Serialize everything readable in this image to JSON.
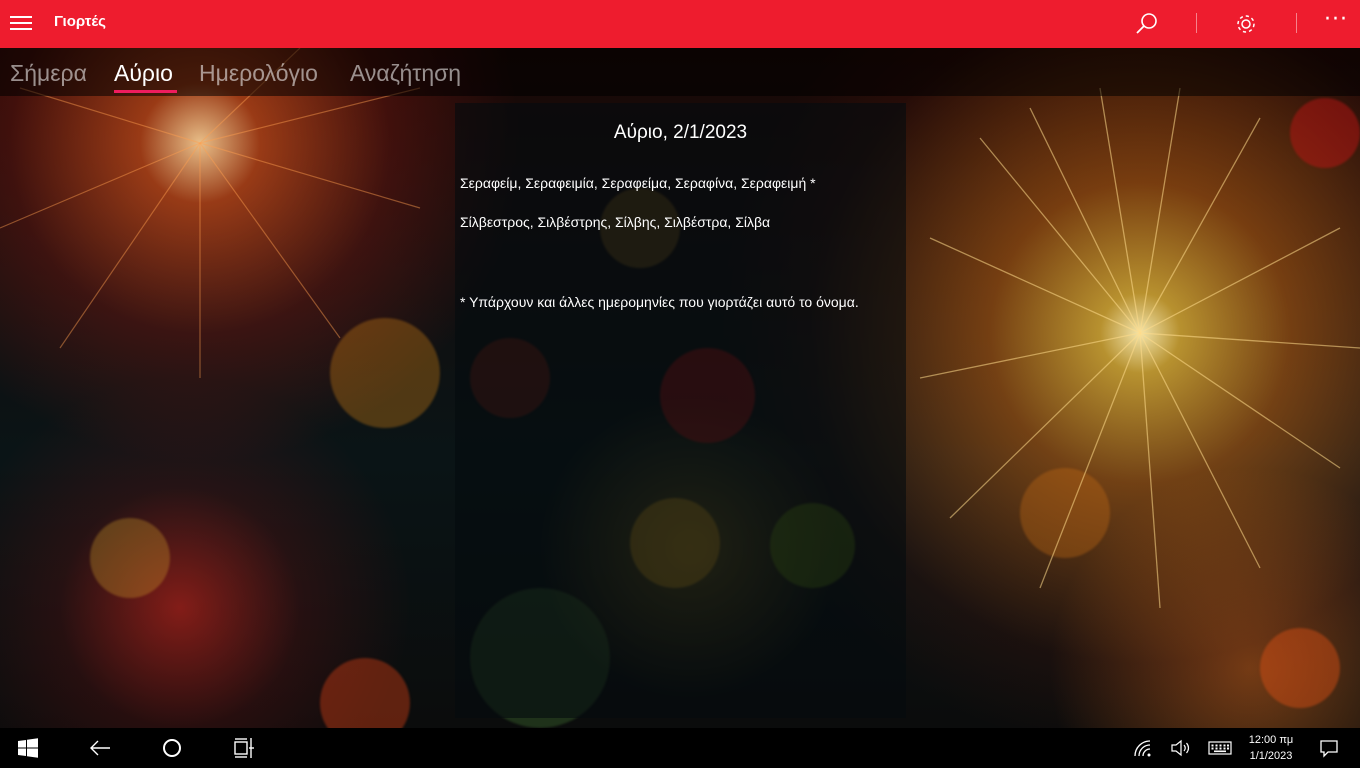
{
  "app": {
    "title": "Γιορτές"
  },
  "pivot": {
    "tabs": [
      {
        "label": "Σήμερα",
        "active": false
      },
      {
        "label": "Αύριο",
        "active": true
      },
      {
        "label": "Ημερολόγιο",
        "active": false
      },
      {
        "label": "Αναζήτηση",
        "active": false
      }
    ]
  },
  "panel": {
    "title": "Αύριο, 2/1/2023",
    "names": [
      "Σεραφείμ, Σεραφειμία, Σεραφείμα, Σεραφίνα, Σεραφειμή *",
      "Σίλβεστρος, Σιλβέστρης, Σίλβης, Σιλβέστρα, Σίλβα"
    ],
    "footnote": "* Υπάρχουν και άλλες ημερομηνίες που γιορτάζει αυτό το όνομα."
  },
  "taskbar": {
    "time": "12:00 πμ",
    "date": "1/1/2023"
  },
  "colors": {
    "accent": "#ee1c2e",
    "pivot_underline": "#ee1c5e"
  },
  "icons": {
    "menu": "hamburger-icon",
    "search": "search-icon",
    "settings": "gear-icon",
    "more": "more-icon"
  }
}
